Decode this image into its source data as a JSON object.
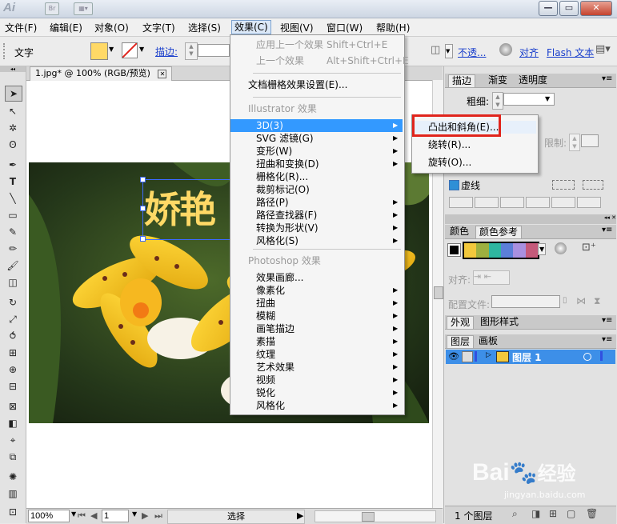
{
  "app": {
    "logo": "Ai",
    "bridge_button": "Br"
  },
  "menubar": [
    {
      "label": "文件(F)"
    },
    {
      "label": "编辑(E)"
    },
    {
      "label": "对象(O)"
    },
    {
      "label": "文字(T)"
    },
    {
      "label": "选择(S)"
    },
    {
      "label": "效果(C)",
      "active": true
    },
    {
      "label": "视图(V)"
    },
    {
      "label": "窗口(W)"
    },
    {
      "label": "帮助(H)"
    }
  ],
  "controlbar": {
    "tool_name": "文字",
    "fill_color": "#ffd966",
    "stroke_label": "描边:",
    "opacity_label": "不透...",
    "align_label": "对齐",
    "flash_text_label": "Flash 文本"
  },
  "document": {
    "tab_title": "1.jpg* @ 100% (RGB/预览)",
    "text_object": "娇艳"
  },
  "status": {
    "zoom": "100%",
    "page": "1",
    "mode": "选择"
  },
  "effect_menu": {
    "top_items": [
      {
        "label": "应用上一个效果",
        "shortcut": "Shift+Ctrl+E",
        "disabled": true
      },
      {
        "label": "上一个效果",
        "shortcut": "Alt+Shift+Ctrl+E",
        "disabled": true
      }
    ],
    "settings_item": "文档栅格效果设置(E)...",
    "illustrator_header": "Illustrator 效果",
    "illustrator_items": [
      {
        "label": "3D(3)",
        "submenu": true,
        "highlighted": true
      },
      {
        "label": "SVG 滤镜(G)",
        "submenu": true
      },
      {
        "label": "变形(W)",
        "submenu": true
      },
      {
        "label": "扭曲和变换(D)",
        "submenu": true
      },
      {
        "label": "栅格化(R)...",
        "submenu": false
      },
      {
        "label": "裁剪标记(O)",
        "submenu": false
      },
      {
        "label": "路径(P)",
        "submenu": true
      },
      {
        "label": "路径查找器(F)",
        "submenu": true
      },
      {
        "label": "转换为形状(V)",
        "submenu": true
      },
      {
        "label": "风格化(S)",
        "submenu": true
      }
    ],
    "photoshop_header": "Photoshop 效果",
    "photoshop_items": [
      {
        "label": "效果画廊...",
        "submenu": false
      },
      {
        "label": "像素化",
        "submenu": true
      },
      {
        "label": "扭曲",
        "submenu": true
      },
      {
        "label": "模糊",
        "submenu": true
      },
      {
        "label": "画笔描边",
        "submenu": true
      },
      {
        "label": "素描",
        "submenu": true
      },
      {
        "label": "纹理",
        "submenu": true
      },
      {
        "label": "艺术效果",
        "submenu": true
      },
      {
        "label": "视频",
        "submenu": true
      },
      {
        "label": "锐化",
        "submenu": true
      },
      {
        "label": "风格化",
        "submenu": true
      }
    ]
  },
  "submenu_3d": [
    {
      "label": "凸出和斜角(E)...",
      "boxed": true
    },
    {
      "label": "绕转(R)..."
    },
    {
      "label": "旋转(O)..."
    }
  ],
  "stroke_panel": {
    "tabs": [
      "描边",
      "渐变",
      "透明度"
    ],
    "weight_label": "粗细:",
    "limit_label": "限制:",
    "dashed_label": "虚线"
  },
  "color_panel": {
    "tabs": [
      "颜色",
      "颜色参考"
    ],
    "swatches": [
      "#f2c83c",
      "#9db03f",
      "#2eb6a0",
      "#5b7fd8",
      "#a990e0",
      "#c55a7a"
    ]
  },
  "align_row": {
    "align_label": "对齐:",
    "config_label": "配置文件:"
  },
  "appearance_panel": {
    "tabs": [
      "外观",
      "图形样式"
    ]
  },
  "layers_panel": {
    "tabs": [
      "图层",
      "画板"
    ],
    "layer_name": "图层 1",
    "count_label": "1 个图层"
  },
  "watermark": {
    "brand": "Bai",
    "brand_suffix": "经验",
    "url": "jingyan.baidu.com"
  }
}
